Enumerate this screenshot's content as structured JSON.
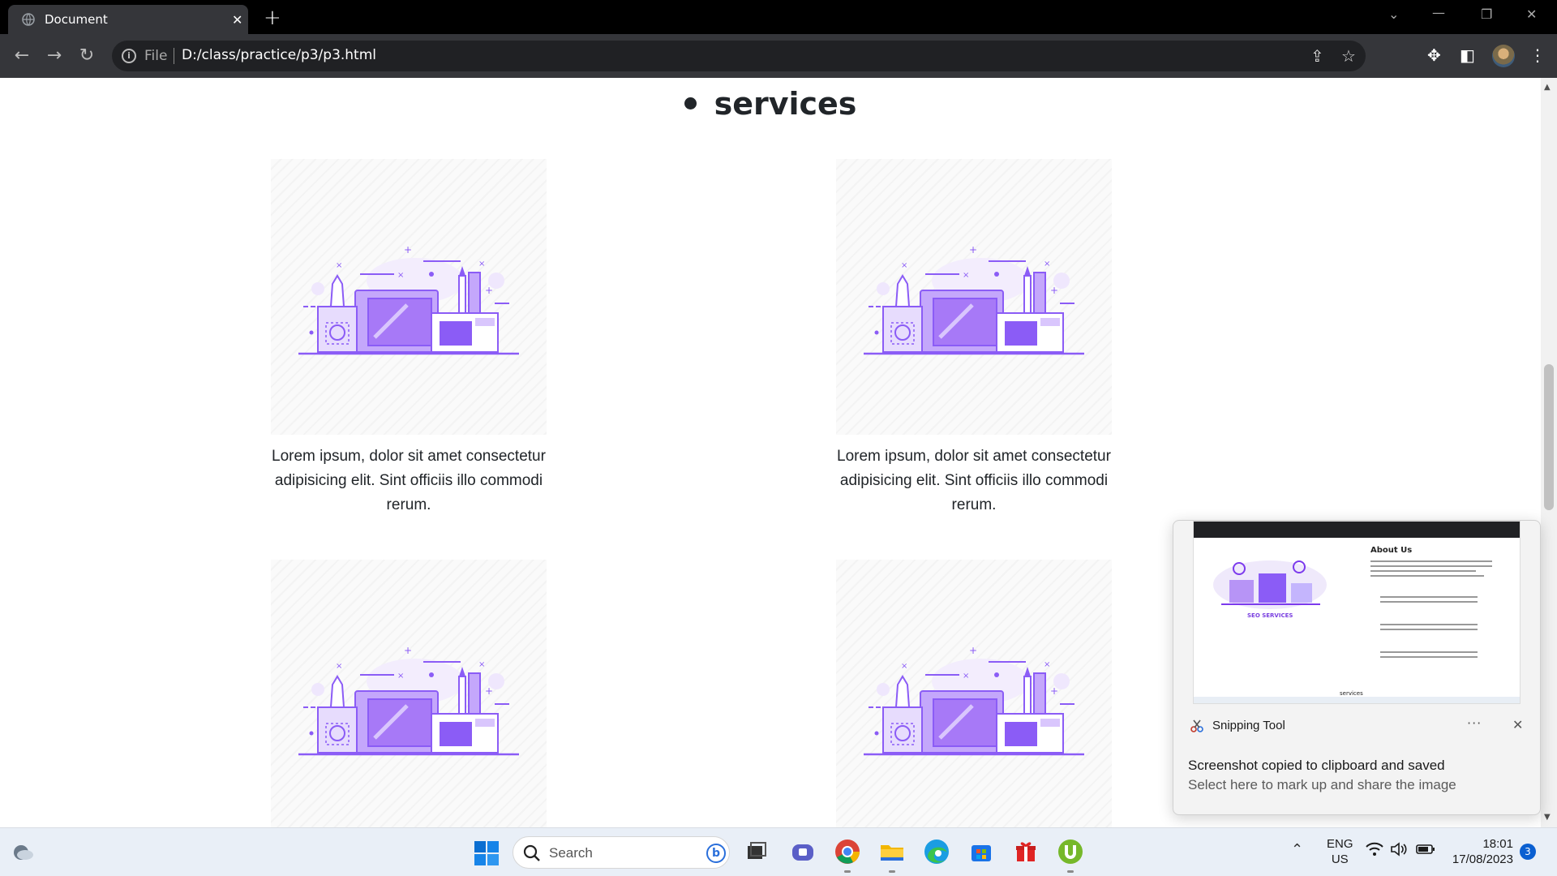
{
  "browser": {
    "tab_title": "Document",
    "tab_close": "✕",
    "new_tab": "+",
    "url_scheme_label": "File",
    "url": "D:/class/practice/p3/p3.html"
  },
  "page": {
    "heading": "services",
    "cards": [
      {
        "text": "Lorem ipsum, dolor sit amet consectetur adipisicing elit. Sint officiis illo commodi rerum."
      },
      {
        "text": "Lorem ipsum, dolor sit amet consectetur adipisicing elit. Sint officiis illo commodi rerum."
      },
      {
        "text": ""
      },
      {
        "text": ""
      }
    ],
    "illustration_color": "#8b5cf6"
  },
  "toast": {
    "app_name": "Snipping Tool",
    "more": "···",
    "close": "✕",
    "title": "Screenshot copied to clipboard and saved",
    "subtitle": "Select here to mark up and share the image",
    "preview": {
      "about_heading": "About Us",
      "seo_label": "SEO SERVICES",
      "services_label": "services"
    }
  },
  "taskbar": {
    "search_placeholder": "Search",
    "bing_label": "b",
    "lang_primary": "ENG",
    "lang_secondary": "US",
    "time": "18:01",
    "date": "17/08/2023",
    "notification_count": "3"
  }
}
